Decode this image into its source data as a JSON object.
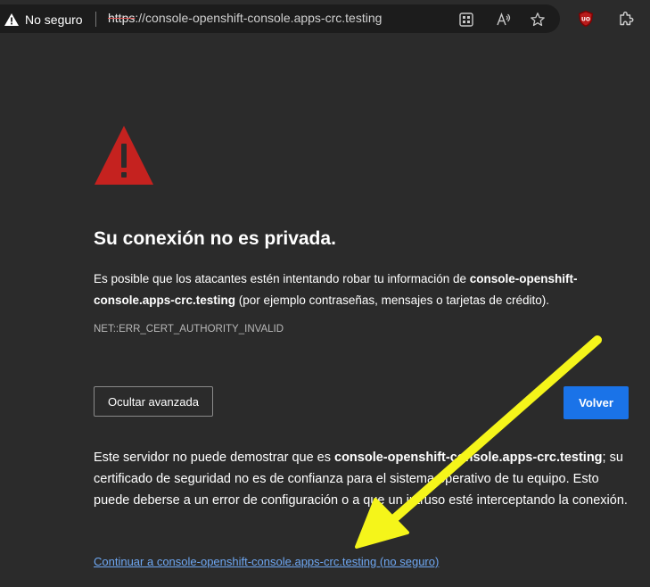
{
  "browser": {
    "security_label": "No seguro",
    "url_scheme": "https",
    "url_rest": "://console-openshift-console.apps-crc.testing",
    "icons": [
      "warning-icon",
      "apps-grid-icon",
      "read-aloud-icon",
      "favorite-star-icon",
      "ublock-icon",
      "extensions-icon"
    ]
  },
  "page": {
    "heading": "Su conexión no es privada.",
    "intro_pre": "Es posible que los atacantes estén intentando robar tu información de ",
    "intro_host": "console-openshift-console.apps-crc.testing",
    "intro_post": " (por ejemplo contraseñas, mensajes o tarjetas de crédito).",
    "error_code": "NET::ERR_CERT_AUTHORITY_INVALID",
    "hide_advanced_label": "Ocultar avanzada",
    "back_label": "Volver",
    "details_pre": "Este servidor no puede demostrar que es ",
    "details_host": "console-openshift-console.apps-crc.testing",
    "details_post": "; su certificado de seguridad no es de confianza para el sistema operativo de tu equipo. Esto puede deberse a un error de configuración o a que un intruso esté interceptando la conexión.",
    "proceed_link": "Continuar a console-openshift-console.apps-crc.testing (no seguro)"
  },
  "colors": {
    "page_bg": "#2b2b2b",
    "omnibox_bg": "#1c1c1c",
    "primary_button": "#1a73e8",
    "link": "#6ea7f2",
    "warning_red": "#c5221f",
    "annotation_yellow": "#f5f51a"
  }
}
